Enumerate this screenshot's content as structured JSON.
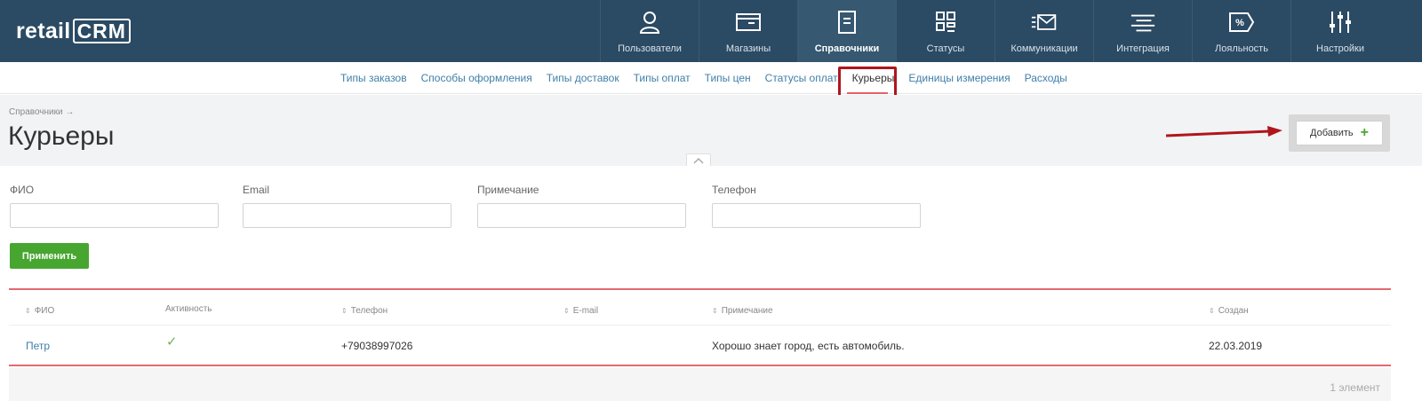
{
  "logo": {
    "retail": "retail",
    "crm": "CRM"
  },
  "topnav": [
    {
      "label": "Пользователи",
      "icon": "user-icon",
      "active": false
    },
    {
      "label": "Магазины",
      "icon": "store-icon",
      "active": false
    },
    {
      "label": "Справочники",
      "icon": "document-icon",
      "active": true
    },
    {
      "label": "Статусы",
      "icon": "statuses-icon",
      "active": false
    },
    {
      "label": "Коммуникации",
      "icon": "mail-icon",
      "active": false
    },
    {
      "label": "Интеграция",
      "icon": "integration-icon",
      "active": false
    },
    {
      "label": "Лояльность",
      "icon": "percent-tag-icon",
      "active": false
    },
    {
      "label": "Настройки",
      "icon": "sliders-icon",
      "active": false
    }
  ],
  "subnav": [
    {
      "label": "Типы заказов"
    },
    {
      "label": "Способы оформления"
    },
    {
      "label": "Типы доставок"
    },
    {
      "label": "Типы оплат"
    },
    {
      "label": "Типы цен"
    },
    {
      "label": "Статусы оплат"
    },
    {
      "label": "Курьеры",
      "active": true
    },
    {
      "label": "Единицы измерения"
    },
    {
      "label": "Расходы"
    }
  ],
  "header": {
    "breadcrumb": "Справочники →",
    "title": "Курьеры",
    "add_label": "Добавить",
    "add_plus": "+"
  },
  "filter": {
    "fields": [
      {
        "label": "ФИО",
        "value": ""
      },
      {
        "label": "Email",
        "value": ""
      },
      {
        "label": "Примечание",
        "value": ""
      },
      {
        "label": "Телефон",
        "value": ""
      }
    ],
    "apply_label": "Применить"
  },
  "table": {
    "columns": {
      "fio": "ФИО",
      "active": "Активность",
      "phone": "Телефон",
      "email": "E-mail",
      "note": "Примечание",
      "created": "Создан"
    },
    "rows": [
      {
        "fio": "Петр",
        "active": "✓",
        "phone": "+79038997026",
        "email": "",
        "note": "Хорошо знает город, есть автомобиль.",
        "created": "22.03.2019"
      }
    ],
    "count": "1 элемент"
  },
  "colors": {
    "topbar": "#2b4a63",
    "accent_green": "#47a630",
    "link": "#3f7fa8",
    "highlight_red": "#b0151d"
  }
}
